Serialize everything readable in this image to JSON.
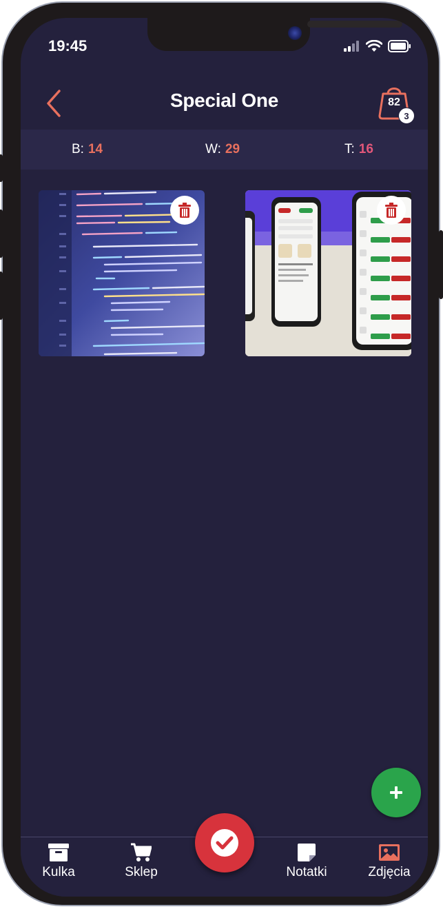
{
  "status_bar": {
    "time": "19:45"
  },
  "header": {
    "title": "Special One",
    "bag_count": "82",
    "bag_badge": "3"
  },
  "stats": [
    {
      "label": "B:",
      "value": "14"
    },
    {
      "label": "W:",
      "value": "29"
    },
    {
      "label": "T:",
      "value": "16"
    }
  ],
  "photos": [
    {
      "name": "code-screenshot-photo"
    },
    {
      "name": "phone-mockup-photo"
    }
  ],
  "tabs": [
    {
      "label": "Kulka",
      "icon": "archive-box-icon"
    },
    {
      "label": "Sklep",
      "icon": "shopping-cart-icon"
    },
    {
      "label": "Notatki",
      "icon": "sticky-note-icon"
    },
    {
      "label": "Zdjęcia",
      "icon": "image-icon",
      "active": true
    }
  ],
  "colors": {
    "background": "#24213d",
    "accent": "#e8705e",
    "fab": "#2aa44b",
    "center_button": "#d7333c",
    "trash": "#c62828"
  }
}
